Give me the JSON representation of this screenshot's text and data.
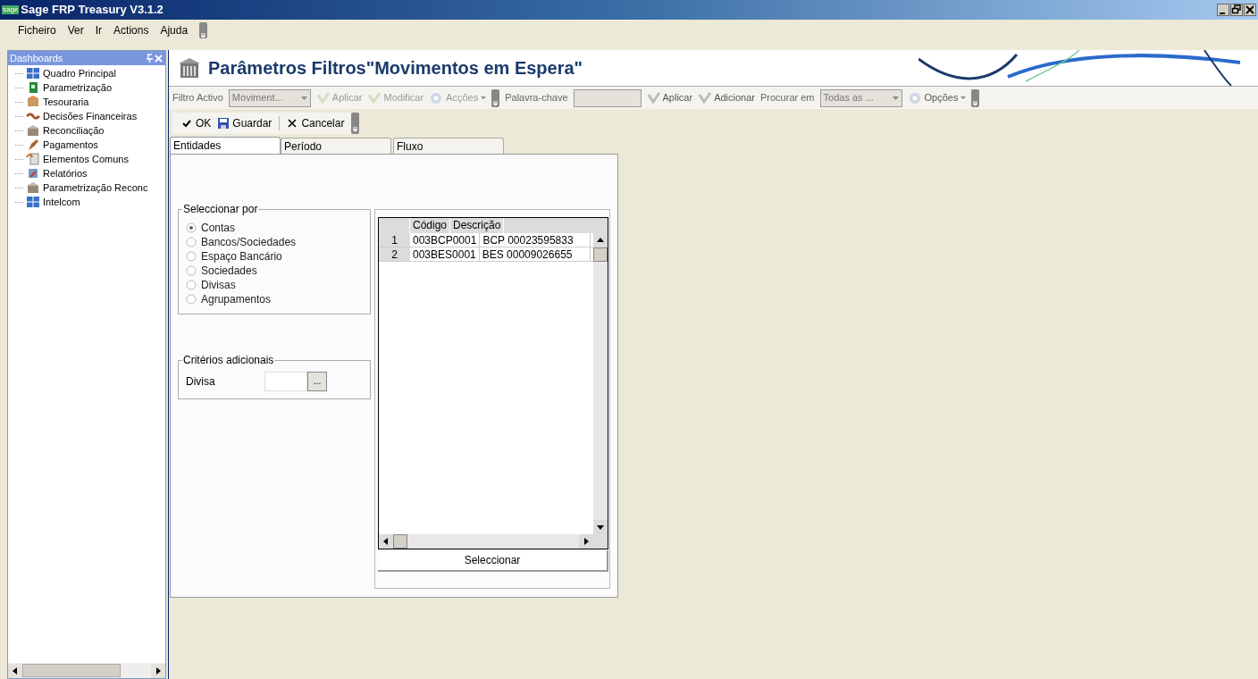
{
  "window": {
    "title": "Sage FRP Treasury V3.1.2",
    "logo": "sage"
  },
  "menu": [
    "Ficheiro",
    "Ver",
    "Ir",
    "Actions",
    "Ajuda"
  ],
  "sidebar": {
    "title": "Dashboards",
    "items": [
      {
        "label": "Quadro Principal"
      },
      {
        "label": "Parametrização"
      },
      {
        "label": "Tesouraria"
      },
      {
        "label": "Decisões Financeiras"
      },
      {
        "label": "Reconciliação"
      },
      {
        "label": "Pagamentos"
      },
      {
        "label": "Elementos Comuns"
      },
      {
        "label": "Relatórios"
      },
      {
        "label": "Parametrização Reconc"
      },
      {
        "label": "Intelcom"
      }
    ]
  },
  "header": {
    "title": "Parâmetros Filtros\"Movimentos em Espera\""
  },
  "toolbar": [
    {
      "kind": "label",
      "text": "Filtro Activo"
    },
    {
      "kind": "dropdown",
      "text": "Moviment..."
    },
    {
      "kind": "button",
      "text": "Aplicar",
      "disabled": true
    },
    {
      "kind": "button",
      "text": "Modificar",
      "disabled": true
    },
    {
      "kind": "menu",
      "text": "Acções",
      "disabled": true
    },
    {
      "kind": "overflow"
    },
    {
      "kind": "label",
      "text": "Palavra-chave"
    },
    {
      "kind": "field"
    },
    {
      "kind": "button",
      "text": "Aplicar",
      "disabled": false
    },
    {
      "kind": "button",
      "text": "Adicionar",
      "disabled": false
    },
    {
      "kind": "label",
      "text": "Procurar em"
    },
    {
      "kind": "dropdown",
      "text": "Todas as ..."
    },
    {
      "kind": "menu",
      "text": "Opções",
      "disabled": false
    },
    {
      "kind": "overflow"
    }
  ],
  "actions": [
    {
      "kind": "ok",
      "text": "OK"
    },
    {
      "kind": "save",
      "text": "Guardar"
    },
    {
      "kind": "cancel",
      "text": "Cancelar"
    }
  ],
  "tabs": [
    {
      "label": "Entidades",
      "selected": true
    },
    {
      "label": "Período",
      "selected": false
    },
    {
      "label": "Fluxo",
      "selected": false
    }
  ],
  "select_by": {
    "title": "Seleccionar por",
    "options": [
      {
        "label": "Contas",
        "selected": true
      },
      {
        "label": "Bancos/Sociedades",
        "selected": false
      },
      {
        "label": "Espaço Bancário",
        "selected": false
      },
      {
        "label": "Sociedades",
        "selected": false
      },
      {
        "label": "Divisas",
        "selected": false
      },
      {
        "label": "Agrupamentos",
        "selected": false
      }
    ]
  },
  "criteria": {
    "title": "Critérios adicionais",
    "label": "Divisa",
    "browse": "..."
  },
  "table": {
    "columns": [
      "Código",
      "Descrição"
    ],
    "rows": [
      {
        "number": "1",
        "cells": [
          "003BCP0001",
          "BCP 00023595833"
        ]
      },
      {
        "number": "2",
        "cells": [
          "003BES0001",
          "BES 00009026655"
        ]
      }
    ]
  },
  "select_button": "Seleccionar"
}
